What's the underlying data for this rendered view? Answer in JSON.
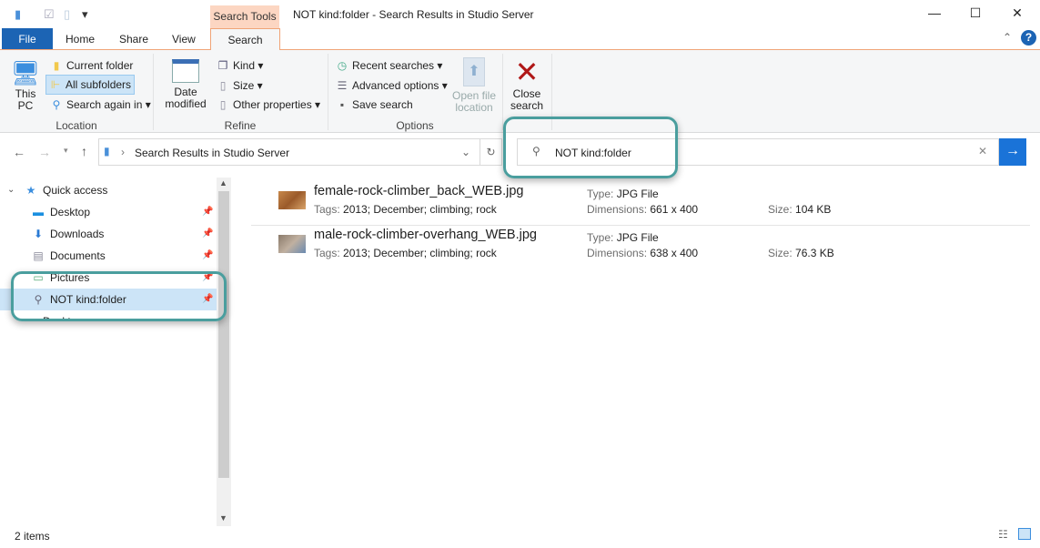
{
  "window": {
    "title": "NOT kind:folder - Search Results in Studio Server",
    "context_tab": "Search Tools"
  },
  "tabs": [
    {
      "label": "File"
    },
    {
      "label": "Home"
    },
    {
      "label": "Share"
    },
    {
      "label": "View"
    },
    {
      "label": "Search"
    }
  ],
  "ribbon": {
    "location": {
      "label": "Location",
      "this_pc": "This PC",
      "current_folder": "Current folder",
      "all_subfolders": "All subfolders",
      "search_again": "Search again in"
    },
    "refine": {
      "label": "Refine",
      "date_modified": "Date modified",
      "kind": "Kind",
      "size": "Size",
      "other_properties": "Other properties"
    },
    "options": {
      "label": "Options",
      "recent_searches": "Recent searches",
      "advanced_options": "Advanced options",
      "save_search": "Save search",
      "open_file_location": "Open file location"
    },
    "close_search": "Close search"
  },
  "address": {
    "path": "Search Results in Studio Server"
  },
  "search": {
    "value": "NOT kind:folder"
  },
  "nav": {
    "items": [
      {
        "label": "Quick access"
      },
      {
        "label": "Desktop"
      },
      {
        "label": "Downloads"
      },
      {
        "label": "Documents"
      },
      {
        "label": "Pictures"
      },
      {
        "label": "NOT kind:folder"
      },
      {
        "label": "Desktop"
      }
    ]
  },
  "files": [
    {
      "name": "female-rock-climber_back_WEB.jpg",
      "tags_label": "Tags:",
      "tags": "2013; December; climbing; rock",
      "type_label": "Type:",
      "type": "JPG File",
      "dim_label": "Dimensions:",
      "dimensions": "661 x 400",
      "size_label": "Size:",
      "size": "104 KB"
    },
    {
      "name": "male-rock-climber-overhang_WEB.jpg",
      "tags_label": "Tags:",
      "tags": "2013; December; climbing; rock",
      "type_label": "Type:",
      "type": "JPG File",
      "dim_label": "Dimensions:",
      "dimensions": "638 x 400",
      "size_label": "Size:",
      "size": "76.3 KB"
    }
  ],
  "status": {
    "count": "2 items"
  },
  "colors": {
    "accent": "#1c64b4",
    "callout": "#4a9e9e",
    "context_tab": "#fcd6c2",
    "selection": "#cce4f7"
  }
}
